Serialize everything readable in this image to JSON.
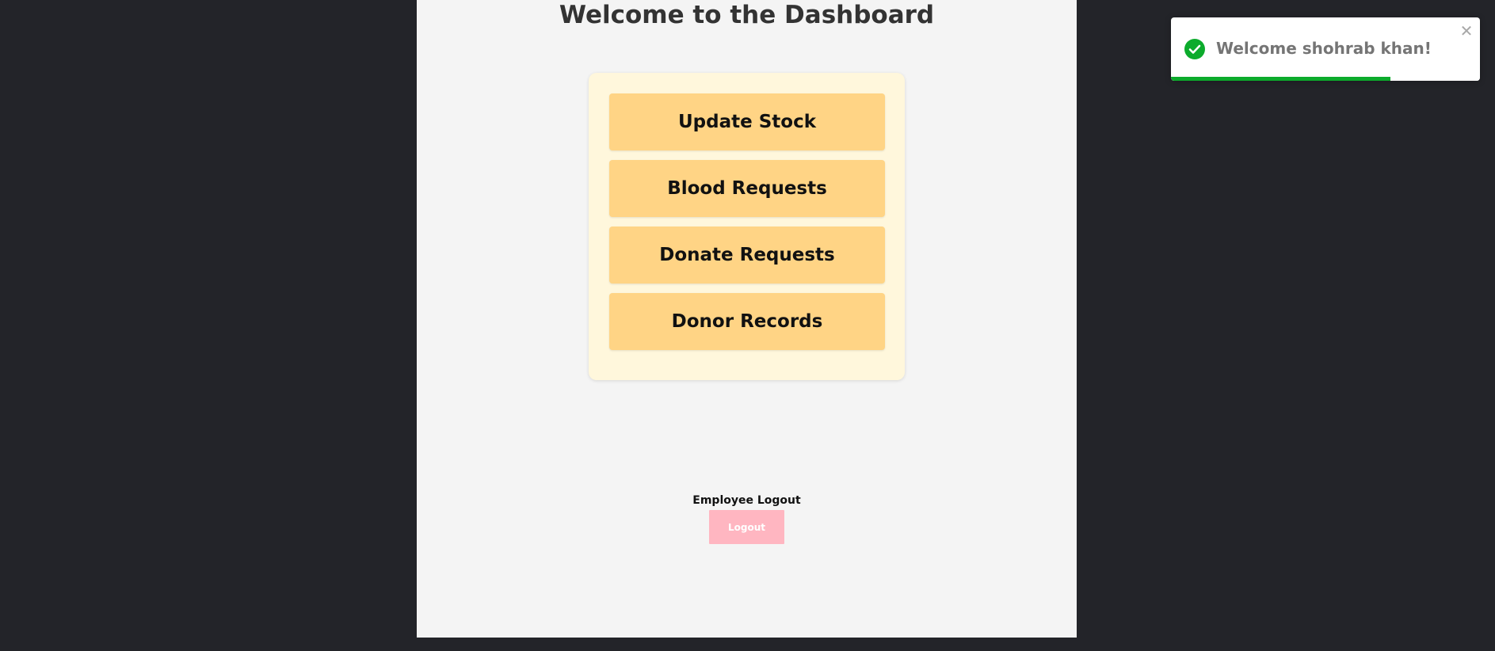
{
  "page": {
    "title": "Welcome to the Dashboard"
  },
  "menu": {
    "items": [
      {
        "label": "Update Stock"
      },
      {
        "label": "Blood Requests"
      },
      {
        "label": "Donate Requests"
      },
      {
        "label": "Donor Records"
      }
    ]
  },
  "logout": {
    "section_label": "Employee Logout",
    "button_label": "Logout"
  },
  "toast": {
    "message": "Welcome shohrab khan!",
    "icon": "check-circle-icon",
    "close_icon": "close-icon",
    "progress": 0.71,
    "accent_color": "#0cab2c"
  },
  "colors": {
    "background": "#232429",
    "panel": "#f4f4f4",
    "card": "#fff7dc",
    "menu_button": "#ffd485",
    "logout_button": "#ffb6c1"
  }
}
